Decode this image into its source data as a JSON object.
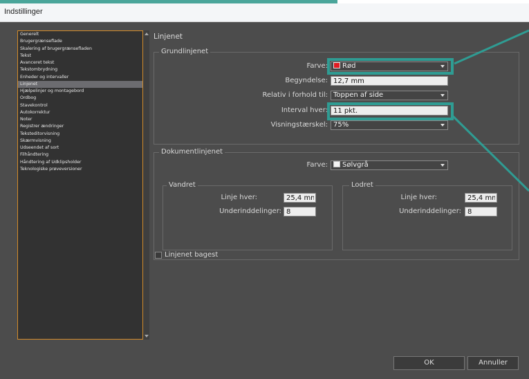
{
  "window": {
    "title": "Indstillinger"
  },
  "colors": {
    "accent_teal": "#2f9c93",
    "list_border": "#d38b2a",
    "red_swatch": "#e11b22"
  },
  "sidebar": {
    "items": [
      "Generelt",
      "Brugergrænseflade",
      "Skalering af brugergrænsefladen",
      "Tekst",
      "Avanceret tekst",
      "Tekstombrydning",
      "Enheder og intervaller",
      "Linjenet",
      "Hjælpelinjer og montagebord",
      "Ordbog",
      "Stavekontrol",
      "Autokorrektur",
      "Noter",
      "Registrer ændringer",
      "Teksteditorvisning",
      "Skærmvisning",
      "Udseendet af sort",
      "Filhåndtering",
      "Håndtering af Udklipsholder",
      "Teknologiske prøveversioner"
    ],
    "selected": "Linjenet"
  },
  "panel": {
    "title": "Linjenet",
    "baseline": {
      "title": "Grundlinjenet",
      "color_label": "Farve:",
      "color_value": "Rød",
      "start_label": "Begyndelse:",
      "start_value": "12,7 mm",
      "relative_label": "Relativ i forhold til:",
      "relative_value": "Toppen af side",
      "interval_label": "Interval hver:",
      "interval_value": "11 pkt.",
      "threshold_label": "Visningstærskel:",
      "threshold_value": "75%"
    },
    "document": {
      "title": "Dokumentlinjenet",
      "color_label": "Farve:",
      "color_value": "Sølvgrå",
      "horizontal": {
        "title": "Vandret",
        "line_label": "Linje hver:",
        "line_value": "25,4 mm",
        "sub_label": "Underinddelinger:",
        "sub_value": "8"
      },
      "vertical": {
        "title": "Lodret",
        "line_label": "Linje hver:",
        "line_value": "25,4 mm",
        "sub_label": "Underinddelinger:",
        "sub_value": "8"
      }
    },
    "grids_back_label": "Linjenet bagest"
  },
  "buttons": {
    "ok": "OK",
    "cancel": "Annuller"
  }
}
